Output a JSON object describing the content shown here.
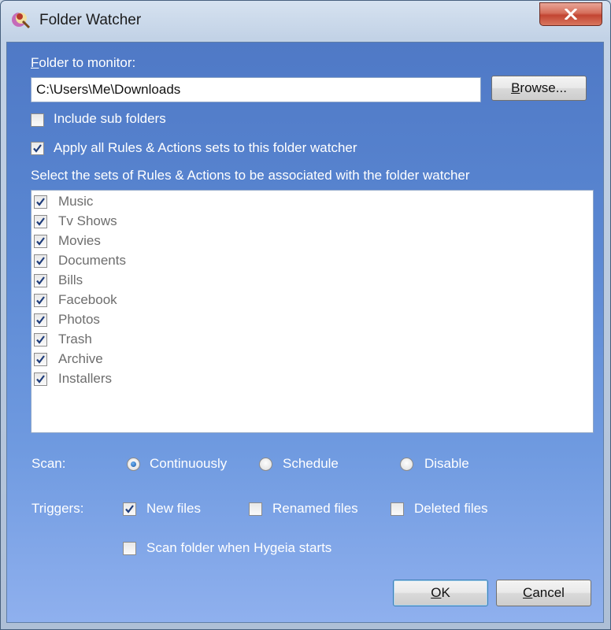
{
  "window": {
    "title": "Folder Watcher"
  },
  "folder": {
    "label_accel": "F",
    "label_rest": "older to monitor:",
    "path": "C:\\Users\\Me\\Downloads",
    "browse_accel": "B",
    "browse_rest": "rowse..."
  },
  "include_sub": {
    "label": "Include sub folders",
    "checked": false
  },
  "apply_all": {
    "label": "Apply all Rules & Actions sets to this folder watcher",
    "checked": true
  },
  "sets": {
    "label": "Select the sets of Rules & Actions to be associated with the folder watcher",
    "items": [
      {
        "label": "Music",
        "checked": true
      },
      {
        "label": "Tv Shows",
        "checked": true
      },
      {
        "label": "Movies",
        "checked": true
      },
      {
        "label": "Documents",
        "checked": true
      },
      {
        "label": "Bills",
        "checked": true
      },
      {
        "label": "Facebook",
        "checked": true
      },
      {
        "label": "Photos",
        "checked": true
      },
      {
        "label": "Trash",
        "checked": true
      },
      {
        "label": "Archive",
        "checked": true
      },
      {
        "label": "Installers",
        "checked": true
      }
    ]
  },
  "scan": {
    "label": "Scan:",
    "options": [
      {
        "label": "Continuously",
        "selected": true
      },
      {
        "label": "Schedule",
        "selected": false
      },
      {
        "label": "Disable",
        "selected": false
      }
    ]
  },
  "triggers": {
    "label": "Triggers:",
    "options": [
      {
        "label": "New files",
        "checked": true
      },
      {
        "label": "Renamed files",
        "checked": false
      },
      {
        "label": "Deleted files",
        "checked": false
      }
    ]
  },
  "scan_on_start": {
    "label": "Scan folder when Hygeia starts",
    "checked": false
  },
  "buttons": {
    "ok_accel": "O",
    "ok_rest": "K",
    "cancel_accel": "C",
    "cancel_rest": "ancel"
  }
}
